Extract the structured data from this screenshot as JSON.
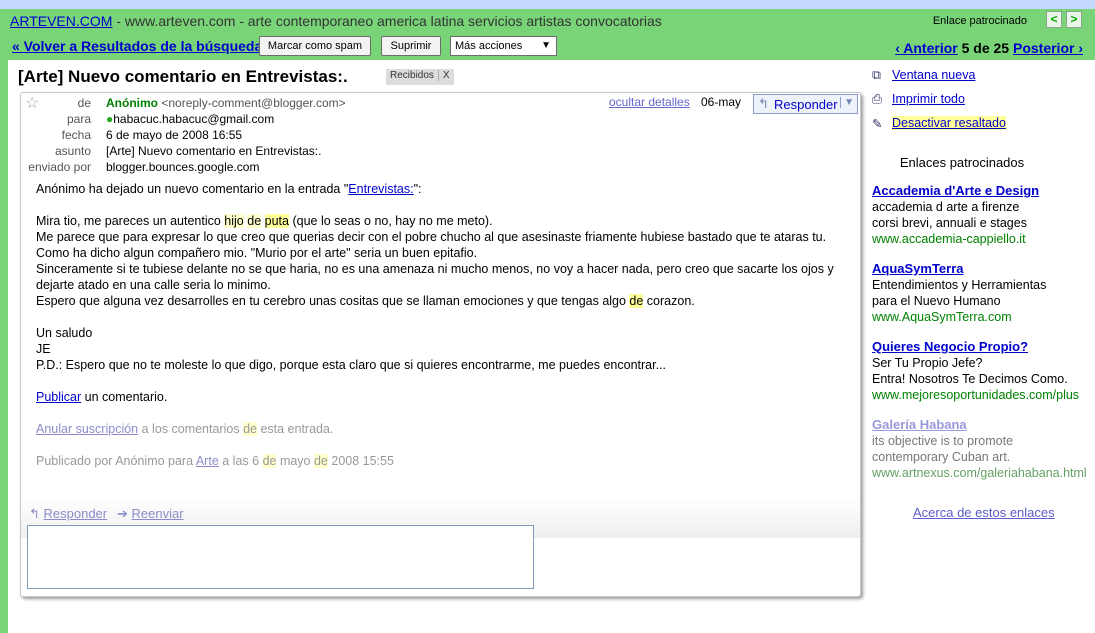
{
  "topad": {
    "site": "ARTEVEN.COM",
    "text": " - www.arteven.com - arte contemporaneo america latina servicios artistas convocatorias",
    "sponsored": "Enlace patrocinado",
    "prev": "<",
    "next": ">"
  },
  "toolbar": {
    "back": "« Volver a Resultados de la búsqueda",
    "spam": "Marcar como spam",
    "delete": "Suprimir",
    "more": "Más acciones",
    "pager_prev": "‹ Anterior",
    "pager_pos": "5 de 25",
    "pager_next": "Posterior ›"
  },
  "message": {
    "subject": "[Arte] Nuevo comentario en Entrevistas:.",
    "label": "Recibidos",
    "label_x": "X",
    "hide_details": "ocultar detalles",
    "date_short": "06-may",
    "reply_btn": "Responder",
    "headers": [
      {
        "k": "de",
        "v": "Anónimo"
      },
      {
        "k": "para",
        "v": "habacuc.habacuc@gmail.com"
      },
      {
        "k": "fecha",
        "v": "6 de mayo de 2008 16:55"
      },
      {
        "k": "asunto",
        "v": "[Arte] Nuevo comentario en Entrevistas:."
      },
      {
        "k": "enviado por",
        "v": "blogger.bounces.google.com"
      }
    ],
    "from_email": "<noreply-comment@blogger.com>",
    "intro_pre": "Anónimo ha dejado un nuevo comentario en la entrada \"",
    "intro_link": "Entrevistas:",
    "intro_post": "\":",
    "b1_pre": "Mira tio, me pareces un autentico ",
    "b1_hl1": "hijo",
    "b1_mid1": " ",
    "b1_hl2": "de",
    "b1_mid2": " ",
    "b1_hl3": "puta",
    "b1_post": " (que lo seas o no, hay no me meto).",
    "b2": "Me parece que para expresar lo que creo que querias decir con el pobre chucho al que asesinaste friamente hubiese bastado que te ataras tu. Como ha dicho algun compañero mio. \"Murio por el arte\" seria un buen epitafio.",
    "b3": "Sinceramente si te tubiese delante no se que haria, no es una amenaza ni mucho menos, no voy a hacer nada, pero creo que sacarte los ojos y dejarte atado en una calle seria lo minimo.",
    "b4_pre": "Espero que alguna vez desarrolles en tu cerebro unas cositas que se llaman emociones y que tengas algo ",
    "b4_hl": "de",
    "b4_post": " corazon.",
    "s1": "Un saludo",
    "s2": "JE",
    "s3": "P.D.: Espero que no te moleste lo que digo, porque esta claro que si quieres encontrarme, me puedes encontrar...",
    "pub_link": "Publicar",
    "pub_post": " un comentario.",
    "unsub_link": "Anular suscripción",
    "unsub_mid": " a los comentarios ",
    "unsub_hl": "de",
    "unsub_post": " esta entrada.",
    "f_pre": "Publicado por Anónimo para ",
    "f_link": "Arte",
    "f_mid1": " a las 6 ",
    "f_hl1": "de",
    "f_mid2": " mayo ",
    "f_hl2": "de",
    "f_post": " 2008 15:55",
    "reply_link": "Responder",
    "forward_link": "Reenviar"
  },
  "sidebar": {
    "new_window": "Ventana nueva",
    "print_all": "Imprimir todo",
    "highlight_off": "Desactivar resaltado",
    "ads_title": "Enlaces patrocinados",
    "ads": [
      {
        "h": "Accademia d'Arte e Design",
        "d1": "accademia d arte a firenze",
        "d2": "corsi brevi, annuali e stages",
        "u": "www.accademia-cappiello.it"
      },
      {
        "h": "AquaSymTerra",
        "d1": "Entendimientos y Herramientas",
        "d2": "para el Nuevo Humano",
        "u": "www.AquaSymTerra.com"
      },
      {
        "h": "Quieres Negocio Propio?",
        "d1": "Ser Tu Propio Jefe?",
        "d2": "Entra! Nosotros Te Decimos Como.",
        "u": "www.mejoresoportunidades.com/plus"
      },
      {
        "h": "Galería Habana",
        "d1": "its objective is to promote",
        "d2": "contemporary Cuban art.",
        "u": "www.artnexus.com/galeriahabana.html"
      }
    ],
    "about": "Acerca de estos enlaces"
  }
}
